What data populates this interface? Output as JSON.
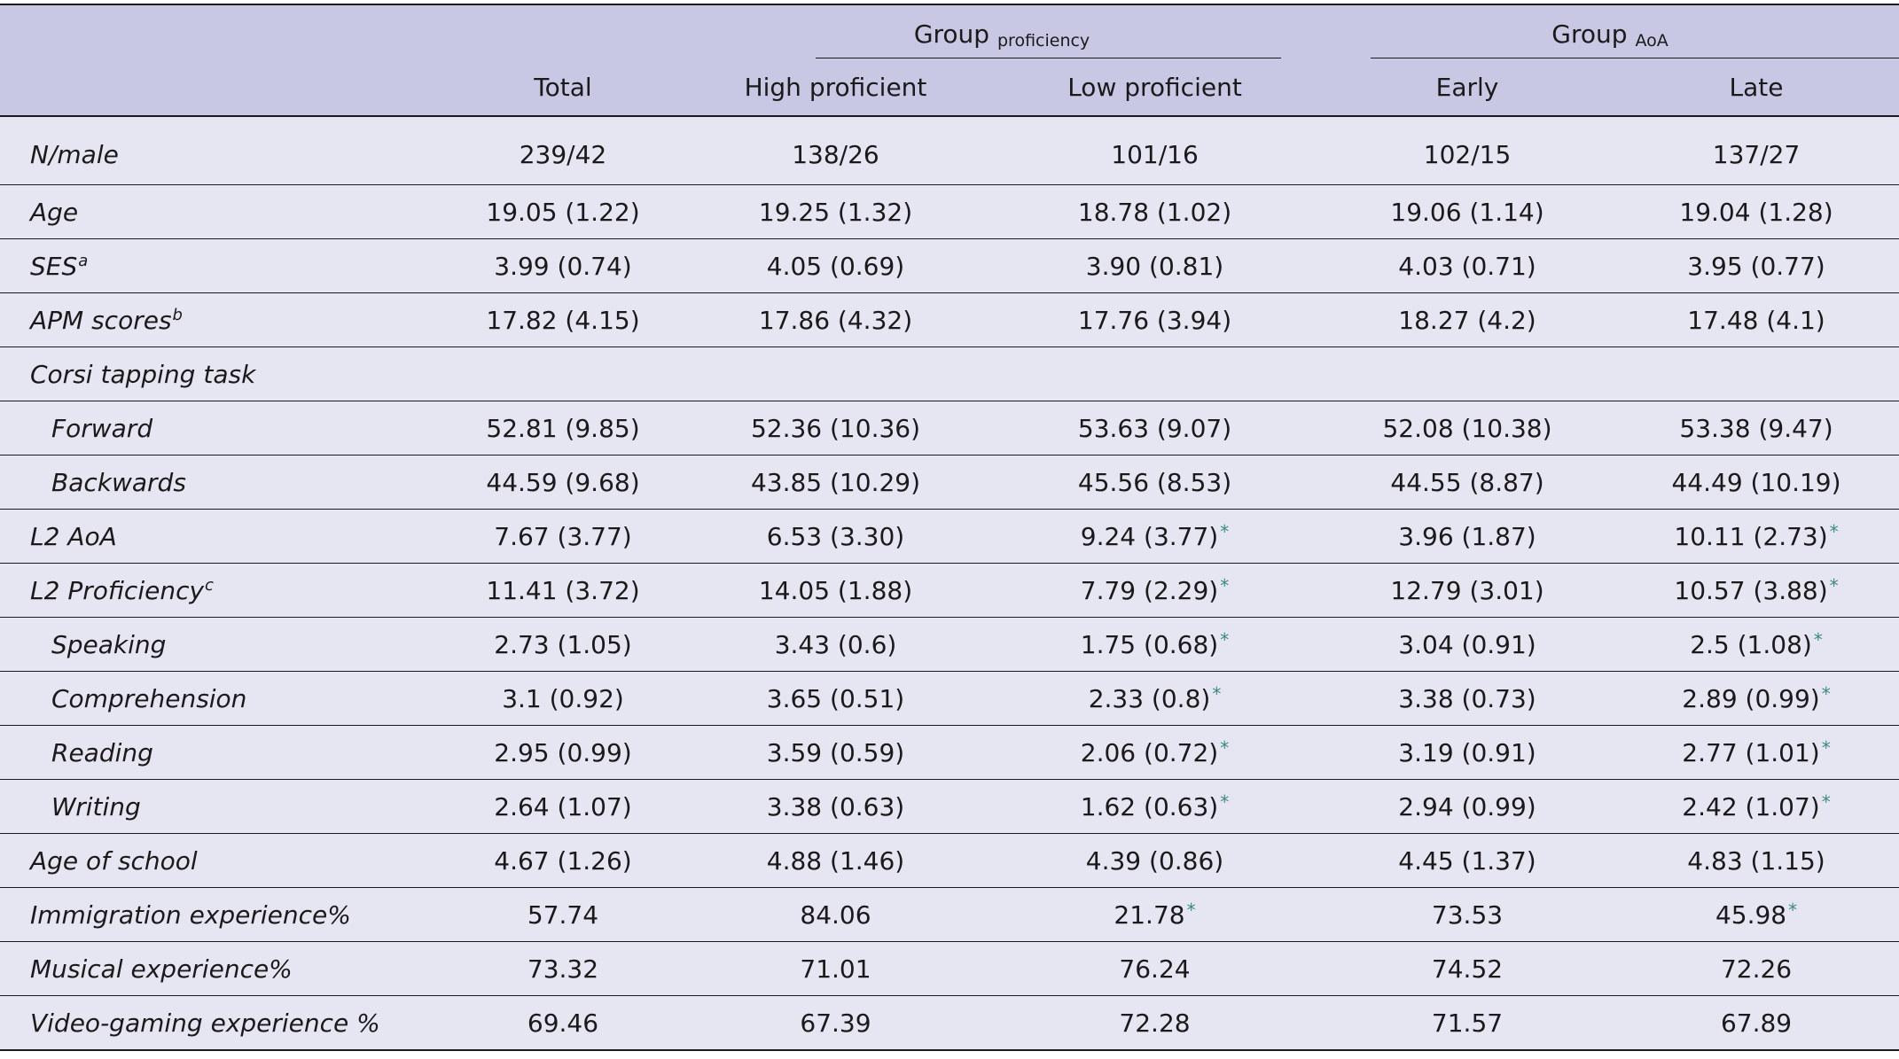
{
  "header": {
    "group_proficiency": {
      "main": "Group",
      "sub": "proficiency"
    },
    "group_aoa": {
      "main": "Group",
      "sub": "AoA"
    },
    "columns": [
      "",
      "Total",
      "High proficient",
      "Low proficient",
      "Early",
      "Late"
    ]
  },
  "rows": [
    {
      "label": "N/male",
      "sup": "",
      "indent": false,
      "cells": [
        "239/42",
        "138/26",
        "101/16",
        "102/15",
        "137/27"
      ],
      "sig": [
        false,
        false,
        false,
        false,
        false
      ]
    },
    {
      "label": "Age",
      "sup": "",
      "indent": false,
      "cells": [
        "19.05 (1.22)",
        "19.25 (1.32)",
        "18.78 (1.02)",
        "19.06 (1.14)",
        "19.04 (1.28)"
      ],
      "sig": [
        false,
        false,
        false,
        false,
        false
      ]
    },
    {
      "label": "SES",
      "sup": "a",
      "indent": false,
      "cells": [
        "3.99 (0.74)",
        "4.05 (0.69)",
        "3.90 (0.81)",
        "4.03 (0.71)",
        "3.95 (0.77)"
      ],
      "sig": [
        false,
        false,
        false,
        false,
        false
      ]
    },
    {
      "label": "APM scores",
      "sup": "b",
      "indent": false,
      "cells": [
        "17.82 (4.15)",
        "17.86 (4.32)",
        "17.76 (3.94)",
        "18.27 (4.2)",
        "17.48 (4.1)"
      ],
      "sig": [
        false,
        false,
        false,
        false,
        false
      ]
    },
    {
      "label": "Corsi tapping task",
      "sup": "",
      "indent": false,
      "cells": [
        "",
        "",
        "",
        "",
        ""
      ],
      "sig": [
        false,
        false,
        false,
        false,
        false
      ]
    },
    {
      "label": "Forward",
      "sup": "",
      "indent": true,
      "cells": [
        "52.81 (9.85)",
        "52.36 (10.36)",
        "53.63 (9.07)",
        "52.08 (10.38)",
        "53.38 (9.47)"
      ],
      "sig": [
        false,
        false,
        false,
        false,
        false
      ]
    },
    {
      "label": "Backwards",
      "sup": "",
      "indent": true,
      "cells": [
        "44.59 (9.68)",
        "43.85 (10.29)",
        "45.56 (8.53)",
        "44.55 (8.87)",
        "44.49 (10.19)"
      ],
      "sig": [
        false,
        false,
        false,
        false,
        false
      ]
    },
    {
      "label": "L2 AoA",
      "sup": "",
      "indent": false,
      "cells": [
        "7.67 (3.77)",
        "6.53 (3.30)",
        "9.24 (3.77)",
        "3.96 (1.87)",
        "10.11 (2.73)"
      ],
      "sig": [
        false,
        false,
        true,
        false,
        true
      ]
    },
    {
      "label": "L2 Proficiency",
      "sup": "c",
      "indent": false,
      "cells": [
        "11.41 (3.72)",
        "14.05 (1.88)",
        "7.79 (2.29)",
        "12.79 (3.01)",
        "10.57 (3.88)"
      ],
      "sig": [
        false,
        false,
        true,
        false,
        true
      ]
    },
    {
      "label": "Speaking",
      "sup": "",
      "indent": true,
      "cells": [
        "2.73 (1.05)",
        "3.43 (0.6)",
        "1.75 (0.68)",
        "3.04 (0.91)",
        "2.5 (1.08)"
      ],
      "sig": [
        false,
        false,
        true,
        false,
        true
      ]
    },
    {
      "label": "Comprehension",
      "sup": "",
      "indent": true,
      "cells": [
        "3.1 (0.92)",
        "3.65 (0.51)",
        "2.33 (0.8)",
        "3.38 (0.73)",
        "2.89 (0.99)"
      ],
      "sig": [
        false,
        false,
        true,
        false,
        true
      ]
    },
    {
      "label": "Reading",
      "sup": "",
      "indent": true,
      "cells": [
        "2.95 (0.99)",
        "3.59 (0.59)",
        "2.06 (0.72)",
        "3.19 (0.91)",
        "2.77 (1.01)"
      ],
      "sig": [
        false,
        false,
        true,
        false,
        true
      ]
    },
    {
      "label": "Writing",
      "sup": "",
      "indent": true,
      "cells": [
        "2.64 (1.07)",
        "3.38 (0.63)",
        "1.62 (0.63)",
        "2.94 (0.99)",
        "2.42 (1.07)"
      ],
      "sig": [
        false,
        false,
        true,
        false,
        true
      ]
    },
    {
      "label": "Age of school",
      "sup": "",
      "indent": false,
      "cells": [
        "4.67 (1.26)",
        "4.88 (1.46)",
        "4.39 (0.86)",
        "4.45 (1.37)",
        "4.83 (1.15)"
      ],
      "sig": [
        false,
        false,
        false,
        false,
        false
      ]
    },
    {
      "label": "Immigration experience%",
      "sup": "",
      "indent": false,
      "cells": [
        "57.74",
        "84.06",
        "21.78",
        "73.53",
        "45.98"
      ],
      "sig": [
        false,
        false,
        true,
        false,
        true
      ]
    },
    {
      "label": "Musical experience%",
      "sup": "",
      "indent": false,
      "cells": [
        "73.32",
        "71.01",
        "76.24",
        "74.52",
        "72.26"
      ],
      "sig": [
        false,
        false,
        false,
        false,
        false
      ]
    },
    {
      "label": "Video-gaming experience %",
      "sup": "",
      "indent": false,
      "cells": [
        "69.46",
        "67.39",
        "72.28",
        "71.57",
        "67.89"
      ],
      "sig": [
        false,
        false,
        false,
        false,
        false
      ]
    }
  ],
  "significance_marker": "*",
  "colors": {
    "header_bg": "#c8c8e4",
    "body_bg": "#e6e6f3",
    "asterisk": "#3a8a80",
    "rule": "#1a1a1a"
  }
}
